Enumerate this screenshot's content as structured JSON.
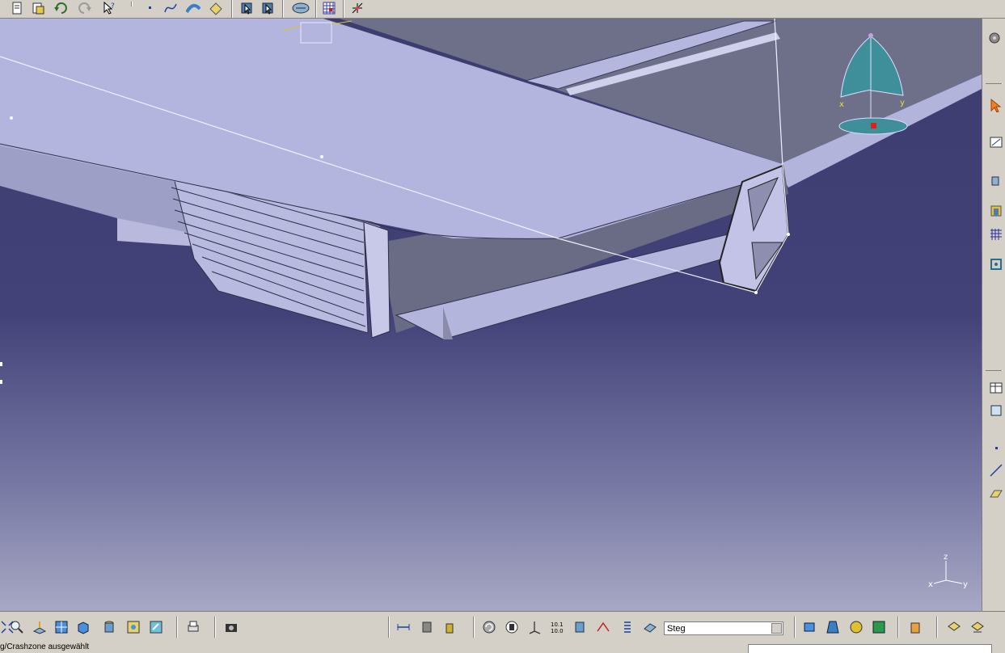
{
  "status": {
    "message": "g/Crashzone ausgewählt"
  },
  "toolbar_bottom": {
    "layer_value": "Steg"
  },
  "compass": {
    "x_label": "x",
    "y_label": "y"
  },
  "axis_triad": {
    "x_label": "x",
    "y_label": "y",
    "z_label": "z"
  },
  "colors": {
    "viewport_top": "#3c3c6e",
    "viewport_bottom": "#a7a8c4",
    "part_face": "#b4b5de",
    "part_dark": "#6b6c86",
    "compass_teal": "#3e8f9a"
  },
  "icons": {
    "top": [
      "new-icon",
      "open-icon",
      "undo-icon",
      "redo-icon",
      "whats-this-icon",
      "point-icon",
      "spline-icon",
      "sweep-icon",
      "eraser-icon",
      "select-icon",
      "select-filter-icon",
      "rotate-icon",
      "grid-icon",
      "snap-icon"
    ],
    "right": [
      "settings-icon",
      "select-arrow-icon",
      "sketch-icon",
      "pad-icon",
      "shell-icon",
      "pattern-icon",
      "constraint-icon",
      "table-icon",
      "plane-icon",
      "point-icon",
      "line-icon",
      "plane-face-icon"
    ],
    "bottom": [
      "fit-all-icon",
      "zoom-icon",
      "normal-view-icon",
      "multi-view-icon",
      "iso-view-icon",
      "shading-icon",
      "hide-show-icon",
      "swap-icon",
      "print-icon",
      "capture-icon",
      "measure-icon",
      "analysis-icon",
      "mass-icon",
      "update-icon",
      "hand-icon",
      "axis-icon",
      "dimension-icon",
      "cylinder-icon",
      "constraint-icon",
      "list-icon",
      "layer-icon",
      "apply-material-icon",
      "texture-icon",
      "render-icon",
      "scene-icon",
      "hand-tool-icon",
      "layers-icon",
      "properties-icon"
    ]
  }
}
